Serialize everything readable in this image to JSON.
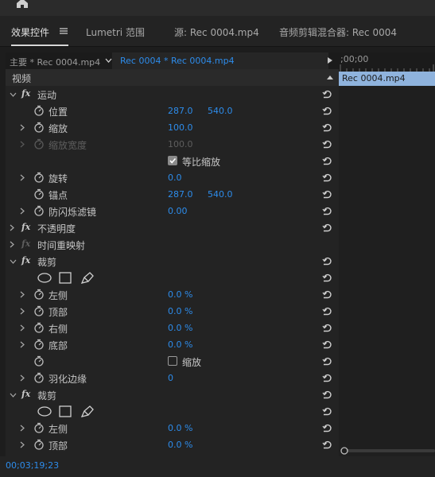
{
  "tabs": [
    {
      "label": "效果控件",
      "active": true
    },
    {
      "label": "Lumetri 范围",
      "active": false
    },
    {
      "label": "源: Rec 0004.mp4",
      "active": false
    },
    {
      "label": "音频剪辑混合器: Rec 0004",
      "active": false
    }
  ],
  "clipbar": {
    "master_label": "主要 * Rec 0004.mp4",
    "sequence_label": "Rec 0004 * Rec 0004.mp4"
  },
  "timeline": {
    "time_label": ";00;00",
    "clip_label": "Rec 0004.mp4"
  },
  "status": {
    "timecode": "00;03;19;23"
  },
  "colors": {
    "accent_blue": "#2d8ceb",
    "clip_blue": "#8fb3dd",
    "panel_bg": "#232323"
  },
  "effects": {
    "section_label": "视频",
    "motion": {
      "name": "运动",
      "position": {
        "label": "位置",
        "x": "287.0",
        "y": "540.0"
      },
      "scale": {
        "label": "缩放",
        "value": "100.0"
      },
      "scale_width": {
        "label": "缩放宽度",
        "value": "100.0"
      },
      "uniform_scale": {
        "label": "等比缩放",
        "checked": true
      },
      "rotation": {
        "label": "旋转",
        "value": "0.0"
      },
      "anchor": {
        "label": "锚点",
        "x": "287.0",
        "y": "540.0"
      },
      "flicker": {
        "label": "防闪烁滤镜",
        "value": "0.00"
      }
    },
    "opacity": {
      "name": "不透明度"
    },
    "time_remap": {
      "name": "时间重映射"
    },
    "crop1": {
      "name": "裁剪",
      "left": {
        "label": "左侧",
        "value": "0.0 %"
      },
      "top": {
        "label": "顶部",
        "value": "0.0 %"
      },
      "right": {
        "label": "右侧",
        "value": "0.0 %"
      },
      "bottom": {
        "label": "底部",
        "value": "0.0 %"
      },
      "zoom": {
        "label": "缩放",
        "checked": false
      },
      "feather": {
        "label": "羽化边缘",
        "value": "0"
      }
    },
    "crop2": {
      "name": "裁剪",
      "left": {
        "label": "左侧",
        "value": "0.0 %"
      },
      "top": {
        "label": "顶部",
        "value": "0.0 %"
      }
    }
  }
}
